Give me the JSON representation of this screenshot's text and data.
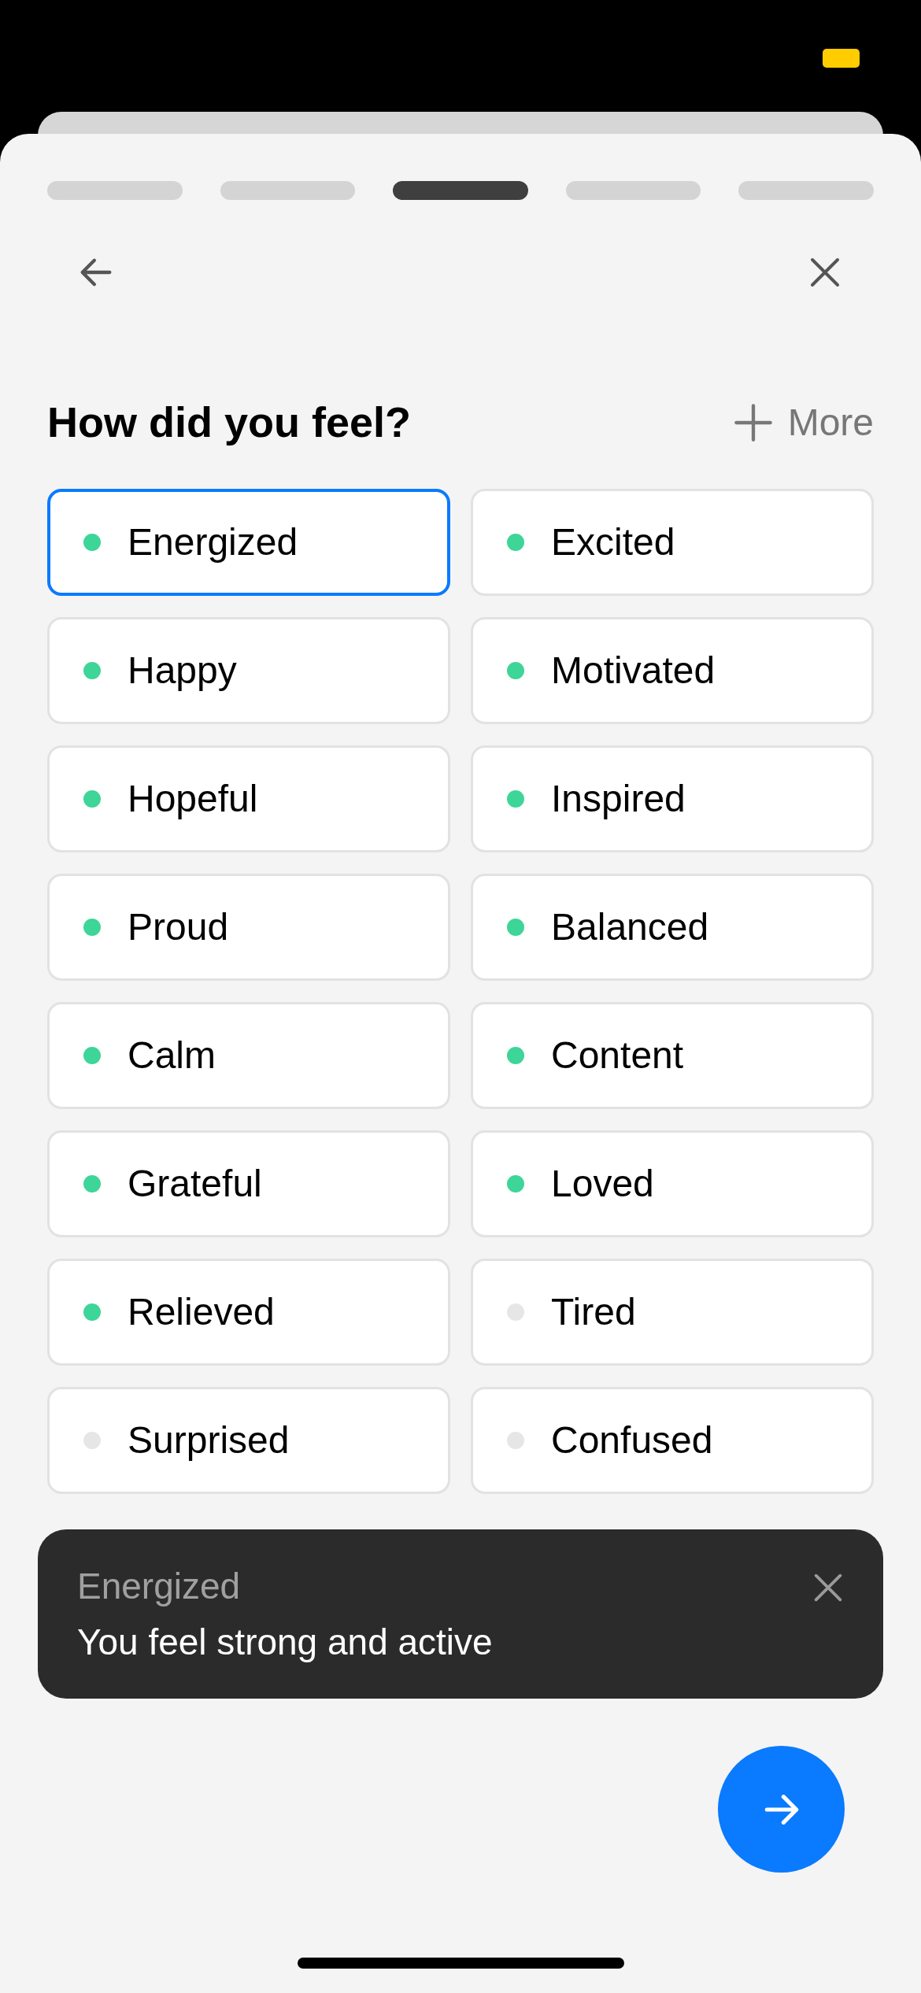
{
  "steps": [
    {
      "selected": false
    },
    {
      "selected": false
    },
    {
      "selected": true
    },
    {
      "selected": false
    },
    {
      "selected": false
    }
  ],
  "title": "How did you feel?",
  "more_button": {
    "label": "More"
  },
  "moods": [
    {
      "name": "Energized",
      "color": "#3dd598",
      "selected": true
    },
    {
      "name": "Excited",
      "color": "#3dd598",
      "selected": false
    },
    {
      "name": "Happy",
      "color": "#3dd598",
      "selected": false
    },
    {
      "name": "Motivated",
      "color": "#3dd598",
      "selected": false
    },
    {
      "name": "Hopeful",
      "color": "#3dd598",
      "selected": false
    },
    {
      "name": "Inspired",
      "color": "#3dd598",
      "selected": false
    },
    {
      "name": "Proud",
      "color": "#3dd598",
      "selected": false
    },
    {
      "name": "Balanced",
      "color": "#3dd598",
      "selected": false
    },
    {
      "name": "Calm",
      "color": "#3dd598",
      "selected": false
    },
    {
      "name": "Content",
      "color": "#3dd598",
      "selected": false
    },
    {
      "name": "Grateful",
      "color": "#3dd598",
      "selected": false
    },
    {
      "name": "Loved",
      "color": "#3dd598",
      "selected": false
    },
    {
      "name": "Relieved",
      "color": "#3dd598",
      "selected": false
    },
    {
      "name": "Tired",
      "color": "#e6e6e6",
      "selected": false
    },
    {
      "name": "Surprised",
      "color": "#e6e6e6",
      "selected": false
    },
    {
      "name": "Confused",
      "color": "#e6e6e6",
      "selected": false
    }
  ],
  "toast": {
    "title": "Energized",
    "message": "You feel strong and active"
  }
}
